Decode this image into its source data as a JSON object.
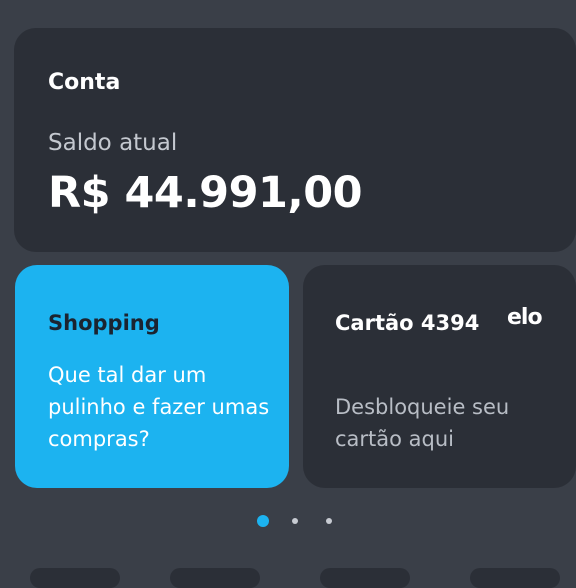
{
  "account": {
    "title": "Conta",
    "balance_label": "Saldo atual",
    "balance_value": "R$ 44.991,00"
  },
  "shopping": {
    "title": "Shopping",
    "text": "Que tal dar um pulinho e fazer umas compras?"
  },
  "card": {
    "title": "Cartão 4394",
    "brand": "elo",
    "text": "Desbloqueie seu cartão aqui"
  },
  "pagination": {
    "count": 3,
    "active": 1
  },
  "colors": {
    "background": "#3a3f48",
    "card": "#2b2f37",
    "accent": "#1cb3f0"
  }
}
